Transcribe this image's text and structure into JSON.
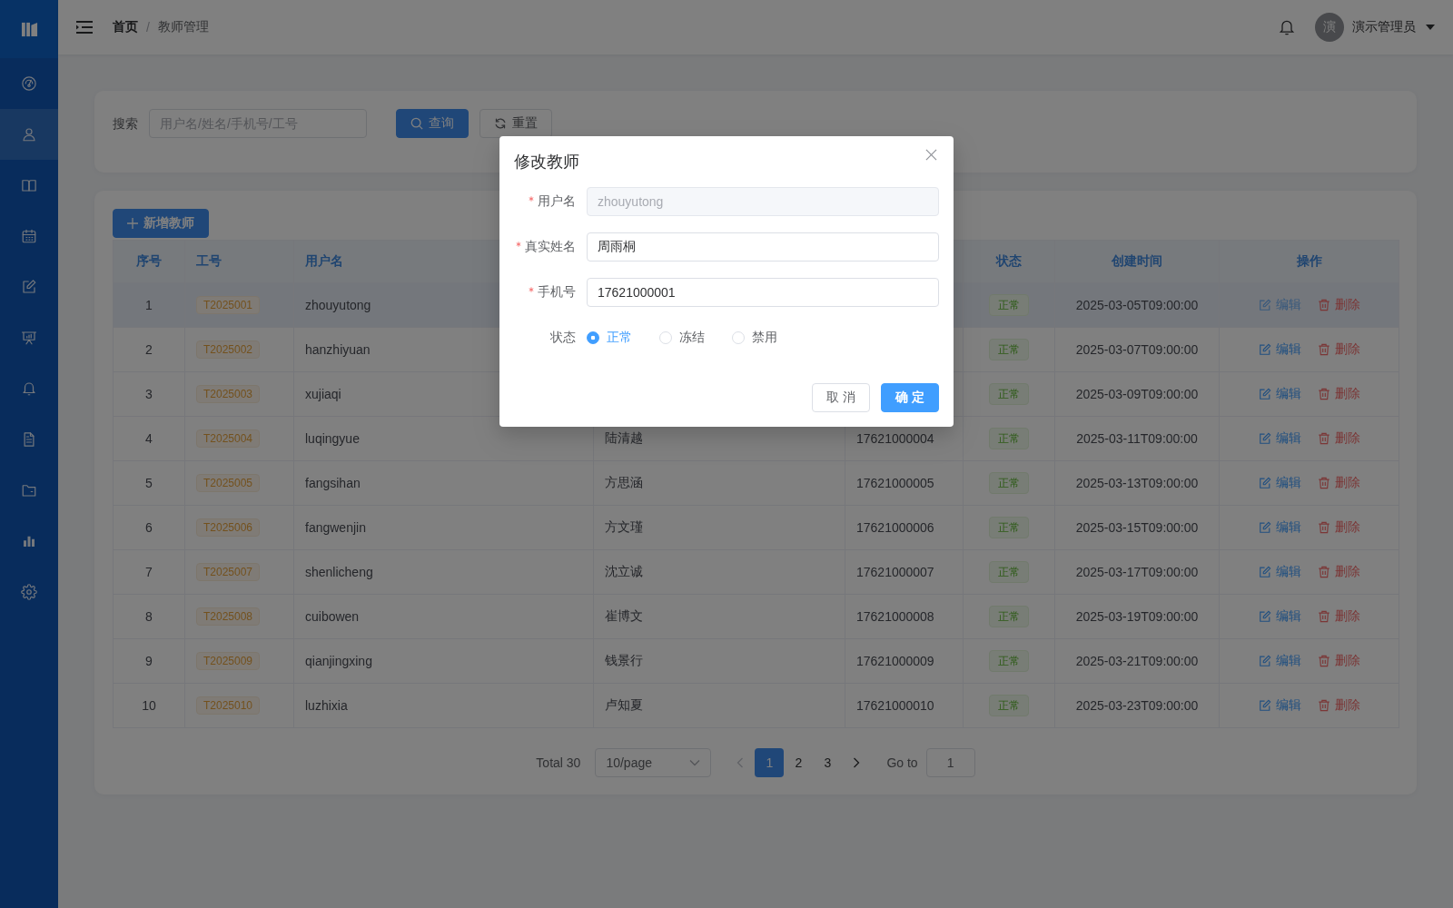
{
  "sidebar": {
    "items": [
      {
        "selected": false
      },
      {
        "selected": true
      },
      {
        "selected": false
      },
      {
        "selected": false
      },
      {
        "selected": false
      },
      {
        "selected": false
      },
      {
        "selected": false
      },
      {
        "selected": false
      },
      {
        "selected": false
      },
      {
        "selected": false
      },
      {
        "selected": false
      }
    ]
  },
  "topbar": {
    "breadcrumb": [
      {
        "label": "首页"
      },
      {
        "label": "教师管理"
      }
    ],
    "separator": "/",
    "user": {
      "avatar": "演",
      "name": "演示管理员"
    }
  },
  "search": {
    "label": "搜索",
    "placeholder": "用户名/姓名/手机号/工号",
    "search_button": "查询",
    "reset_button": "重置"
  },
  "add_button": "新增教师",
  "table": {
    "header": {
      "index": "序号",
      "code": "工号",
      "username": "用户名",
      "status": "状态",
      "created": "创建时间",
      "actions": "操作"
    },
    "rows": [
      {
        "selected": true,
        "index": "1",
        "code": "T2025001",
        "username": "zhouyutong",
        "status": "正常",
        "created": "2025-03-05T09:00:00",
        "edit": "编辑",
        "delete": "删除"
      },
      {
        "selected": false,
        "index": "2",
        "code": "T2025002",
        "username": "hanzhiyuan",
        "status": "正常",
        "created": "2025-03-07T09:00:00",
        "edit": "编辑",
        "delete": "删除"
      },
      {
        "selected": false,
        "index": "3",
        "code": "T2025003",
        "username": "xujiaqi",
        "status": "正常",
        "created": "2025-03-09T09:00:00",
        "edit": "编辑",
        "delete": "删除"
      },
      {
        "selected": false,
        "index": "4",
        "code": "T2025004",
        "username": "luqingyue",
        "real_name": "陆清越",
        "phone": "17621000004",
        "status": "正常",
        "created": "2025-03-11T09:00:00",
        "edit": "编辑",
        "delete": "删除"
      },
      {
        "selected": false,
        "index": "5",
        "code": "T2025005",
        "username": "fangsihan",
        "real_name": "方思涵",
        "phone": "17621000005",
        "status": "正常",
        "created": "2025-03-13T09:00:00",
        "edit": "编辑",
        "delete": "删除"
      },
      {
        "selected": false,
        "index": "6",
        "code": "T2025006",
        "username": "fangwenjin",
        "real_name": "方文瑾",
        "phone": "17621000006",
        "status": "正常",
        "created": "2025-03-15T09:00:00",
        "edit": "编辑",
        "delete": "删除"
      },
      {
        "selected": false,
        "index": "7",
        "code": "T2025007",
        "username": "shenlicheng",
        "real_name": "沈立诚",
        "phone": "17621000007",
        "status": "正常",
        "created": "2025-03-17T09:00:00",
        "edit": "编辑",
        "delete": "删除"
      },
      {
        "selected": false,
        "index": "8",
        "code": "T2025008",
        "username": "cuibowen",
        "real_name": "崔博文",
        "phone": "17621000008",
        "status": "正常",
        "created": "2025-03-19T09:00:00",
        "edit": "编辑",
        "delete": "删除"
      },
      {
        "selected": false,
        "index": "9",
        "code": "T2025009",
        "username": "qianjingxing",
        "real_name": "钱景行",
        "phone": "17621000009",
        "status": "正常",
        "created": "2025-03-21T09:00:00",
        "edit": "编辑",
        "delete": "删除"
      },
      {
        "selected": false,
        "index": "10",
        "code": "T2025010",
        "username": "luzhixia",
        "real_name": "卢知夏",
        "phone": "17621000010",
        "status": "正常",
        "created": "2025-03-23T09:00:00",
        "edit": "编辑",
        "delete": "删除"
      }
    ]
  },
  "pagination": {
    "total": "Total 30",
    "page_size": "10/page",
    "pages": [
      {
        "label": "1",
        "selected": true
      },
      {
        "label": "2",
        "selected": false
      },
      {
        "label": "3",
        "selected": false
      }
    ],
    "goto_label": "Go to",
    "goto_value": "1"
  },
  "modal": {
    "title": "修改教师",
    "fields": [
      {
        "kind": "input",
        "label": "用户名",
        "required": true,
        "disabled": true,
        "value": "zhouyutong"
      },
      {
        "kind": "input",
        "label": "真实姓名",
        "required": true,
        "disabled": false,
        "value": "周雨桐"
      },
      {
        "kind": "input",
        "label": "手机号",
        "required": true,
        "disabled": false,
        "value": "17621000001"
      },
      {
        "kind": "radio",
        "label": "状态",
        "required": false,
        "options": [
          {
            "label": "正常",
            "selected": true
          },
          {
            "label": "冻结",
            "selected": false
          },
          {
            "label": "禁用",
            "selected": false
          }
        ]
      }
    ],
    "buttons": [
      {
        "kind": "default",
        "label": "取 消"
      },
      {
        "kind": "primary",
        "label": "确 定"
      }
    ]
  }
}
